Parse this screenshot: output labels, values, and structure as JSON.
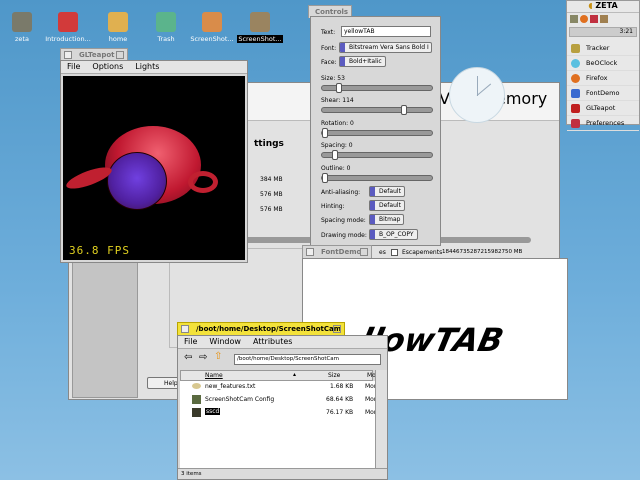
{
  "desktop_icons": [
    {
      "label": "zeta",
      "color": "#7a7a6a"
    },
    {
      "label": "Introduction...",
      "color": "#d23a3a"
    },
    {
      "label": "home",
      "color": "#e0b050"
    },
    {
      "label": "Trash",
      "color": "#5bb48c"
    },
    {
      "label": "ScreenShot...",
      "color": "#d98c4a"
    },
    {
      "label": "ScreenShot...",
      "color": "#9a8460",
      "selected": true
    }
  ],
  "vm_window": {
    "title_fragment": "Vir",
    "title_fragment2": "emory",
    "settings_fragment": "ttings",
    "values": [
      "384 MB",
      "576 MB",
      "576 MB"
    ],
    "checkbox_label_fragment": "es",
    "escapements": "Escapements",
    "big_value": "18446735287215982750 MB",
    "help_button": "Help"
  },
  "glteapot": {
    "title": "GLTeapot",
    "menu": [
      "File",
      "Options",
      "Lights"
    ],
    "fps": "36.8 FPS"
  },
  "controls": {
    "title": "Controls",
    "text_label": "Text:",
    "text_value": "yellowTAB",
    "font_label": "Font:",
    "font_value": "Bitstream Vera Sans Bold I",
    "face_label": "Face:",
    "face_value": "Bold+Italic",
    "sliders": [
      {
        "label": "Size: 53",
        "fraction": 0.15
      },
      {
        "label": "Shear: 114",
        "fraction": 0.75
      },
      {
        "label": "Rotation: 0",
        "fraction": 0
      },
      {
        "label": "Spacing: 0",
        "fraction": 0.1
      },
      {
        "label": "Outline: 0",
        "fraction": 0
      }
    ],
    "options": [
      {
        "label": "Anti-aliasing:",
        "value": "Default"
      },
      {
        "label": "Hinting:",
        "value": "Default"
      },
      {
        "label": "Spacing mode:",
        "value": "Bitmap"
      },
      {
        "label": "Drawing mode:",
        "value": "B_OP_COPY"
      }
    ]
  },
  "fontdemo": {
    "title": "FontDemo",
    "rendered_text": "llowTAB"
  },
  "tracker": {
    "title": "/boot/home/Desktop/ScreenShotCam",
    "menu": [
      "File",
      "Window",
      "Attributes"
    ],
    "path": "/boot/home/Desktop/ScreenShotCam",
    "columns": [
      "Name",
      "Size",
      "Mod"
    ],
    "rows": [
      {
        "name": "new_features.txt",
        "size": "1.68 KB",
        "mod": "Mon"
      },
      {
        "name": "ScreenShotCam Config",
        "size": "68.64 KB",
        "mod": "Mon"
      },
      {
        "name": "sscd",
        "size": "76.17 KB",
        "mod": "Mon"
      }
    ],
    "status": "3 items"
  },
  "deskbar": {
    "brand": "ZETA",
    "clock": "3:21",
    "items": [
      {
        "label": "Tracker",
        "color": "#b8a040"
      },
      {
        "label": "BeOClock",
        "color": "#5ac0e0"
      },
      {
        "label": "Firefox",
        "color": "#e07020"
      },
      {
        "label": "FontDemo",
        "color": "#3a6ad0"
      },
      {
        "label": "GLTeapot",
        "color": "#c02020"
      },
      {
        "label": "Preferences",
        "color": "#c03040"
      }
    ]
  }
}
